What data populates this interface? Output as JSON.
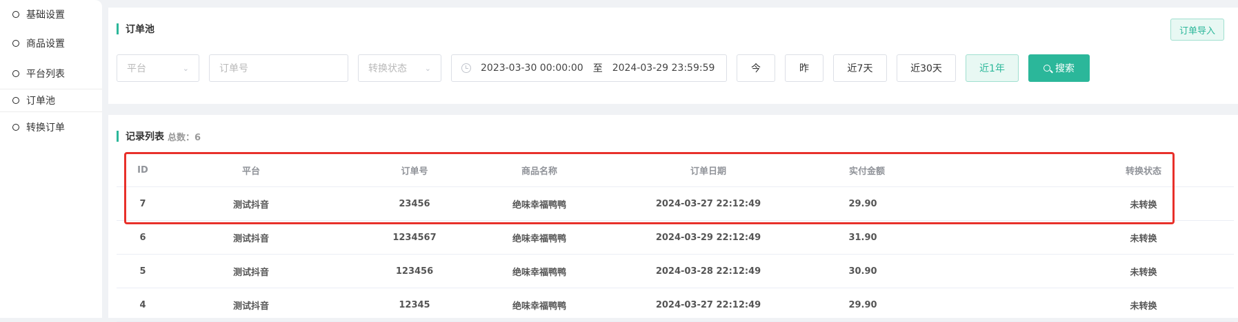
{
  "sidebar": {
    "items": [
      {
        "label": "基础设置"
      },
      {
        "label": "商品设置"
      },
      {
        "label": "平台列表"
      },
      {
        "label": "订单池"
      },
      {
        "label": "转换订单"
      }
    ]
  },
  "filter": {
    "title": "订单池",
    "import_label": "订单导入",
    "platform_placeholder": "平台",
    "order_no_placeholder": "订单号",
    "status_placeholder": "转换状态",
    "date_start": "2023-03-30 00:00:00",
    "date_sep": "至",
    "date_end": "2024-03-29 23:59:59",
    "quick": [
      "今",
      "昨",
      "近7天",
      "近30天",
      "近1年"
    ],
    "search_label": "搜索",
    "accent": "#2bb79a"
  },
  "list": {
    "title": "记录列表",
    "count_label": "总数：6",
    "headers": [
      "ID",
      "平台",
      "订单号",
      "商品名称",
      "订单日期",
      "实付金额",
      "转换状态"
    ],
    "rows": [
      {
        "id": "7",
        "platform": "测试抖音",
        "order_no": "23456",
        "product": "绝味幸福鸭鸭",
        "date": "2024-03-27 22:12:49",
        "amount": "29.90",
        "status": "未转换"
      },
      {
        "id": "6",
        "platform": "测试抖音",
        "order_no": "1234567",
        "product": "绝味幸福鸭鸭",
        "date": "2024-03-29 22:12:49",
        "amount": "31.90",
        "status": "未转换"
      },
      {
        "id": "5",
        "platform": "测试抖音",
        "order_no": "123456",
        "product": "绝味幸福鸭鸭",
        "date": "2024-03-28 22:12:49",
        "amount": "30.90",
        "status": "未转换"
      },
      {
        "id": "4",
        "platform": "测试抖音",
        "order_no": "12345",
        "product": "绝味幸福鸭鸭",
        "date": "2024-03-27 22:12:49",
        "amount": "29.90",
        "status": "未转换"
      }
    ]
  },
  "highlight_color": "#e8302a"
}
